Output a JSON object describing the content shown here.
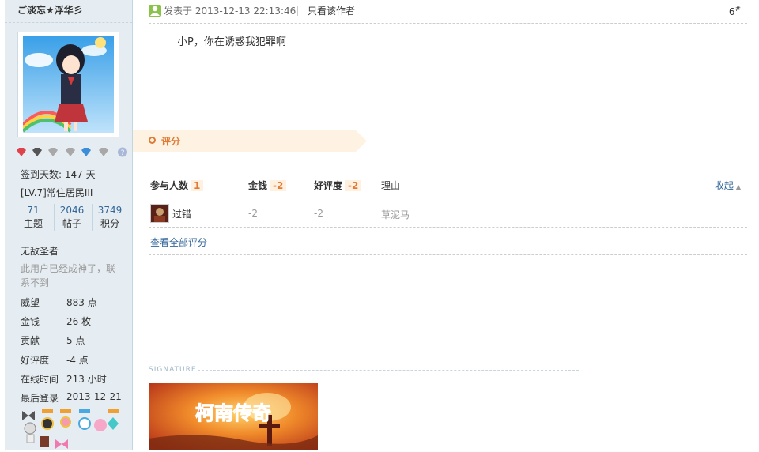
{
  "author": {
    "username": "ご淡忘★浮华彡",
    "avatar_icon": "anime-girl-avatar",
    "checkin": "签到天数: 147 天",
    "level": "[LV.7]常住居民III",
    "counts": [
      {
        "num": "71",
        "label": "主题"
      },
      {
        "num": "2046",
        "label": "帖子"
      },
      {
        "num": "3749",
        "label": "积分"
      }
    ],
    "group": "无敌圣者",
    "custom_title": "此用户已经成神了，联系不到",
    "profile": [
      {
        "key": "威望",
        "value": "883 点"
      },
      {
        "key": "金钱",
        "value": "26 枚"
      },
      {
        "key": "贡献",
        "value": "5 点"
      },
      {
        "key": "好评度",
        "value": "-4 点"
      },
      {
        "key": "在线时间",
        "value": "213 小时"
      },
      {
        "key": "最后登录",
        "value": "2013-12-21"
      }
    ]
  },
  "post": {
    "posted": "发表于 2013-12-13 22:13:46",
    "only_author": "只看该作者",
    "floor": "6",
    "floor_mark": "#",
    "content": "小P，你在诱惑我犯罪啊"
  },
  "rating": {
    "title": "评分",
    "headers": {
      "participants": "参与人数",
      "participants_count": "1",
      "money": "金钱",
      "money_total": "-2",
      "rep": "好评度",
      "rep_total": "-2",
      "reason": "理由"
    },
    "collapse": "收起",
    "rows": [
      {
        "user": "过错",
        "money": "-2",
        "rep": "-2",
        "reason": "草泥马"
      }
    ],
    "view_all": "查看全部评分"
  },
  "signature": {
    "label": "SIGNATURE",
    "banner_text": "柯南传奇"
  },
  "colors": {
    "sidebar_bg": "#e5edf2",
    "link": "#336699",
    "accent": "#e07a35",
    "rate_band": "#fef3e2"
  }
}
